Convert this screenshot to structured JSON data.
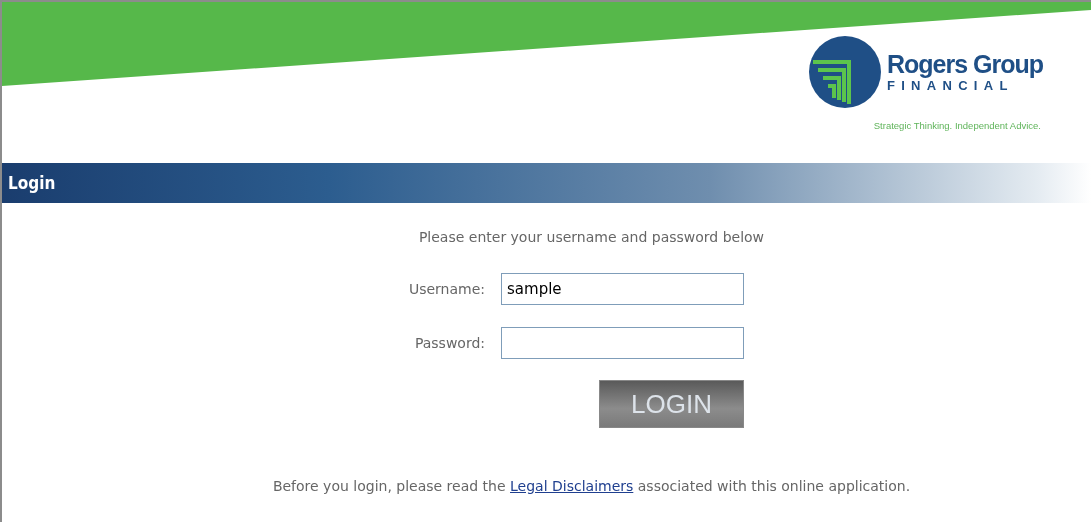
{
  "brand": {
    "name": "Rogers Group",
    "subtitle": "FINANCIAL",
    "tagline": "Strategic Thinking. Independent Advice."
  },
  "section_title": "Login",
  "instructions": "Please enter your username and password below",
  "fields": [
    {
      "label": "Username:",
      "value": "sample",
      "kind": "text"
    },
    {
      "label": "Password:",
      "kind": "password"
    }
  ],
  "login_button": "LOGIN",
  "disclaimer": {
    "before": "Before you login, please read the",
    "link": "Legal Disclaimers",
    "after": "associated with this online application."
  }
}
